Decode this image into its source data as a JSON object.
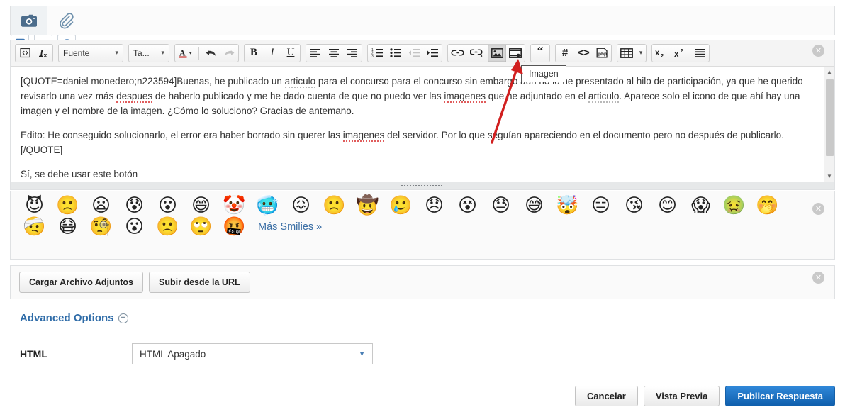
{
  "topbar": {
    "tabs": [
      {
        "name": "camera-tab",
        "icon": "camera-icon",
        "active": true
      },
      {
        "name": "attachment-tab",
        "icon": "paperclip-icon",
        "active": false
      }
    ],
    "right_icons": [
      {
        "name": "paste-icon",
        "label": "Pegar"
      },
      {
        "name": "font-format-icon",
        "label": "Formato de texto"
      },
      {
        "name": "smiley-icon",
        "label": "Smilies"
      }
    ]
  },
  "toolbar": {
    "groups": [
      {
        "buttons": [
          {
            "name": "source-code-button",
            "glyph": "source",
            "label": "Código fuente"
          },
          {
            "name": "remove-format-button",
            "glyph": "removeformat",
            "label": "Quitar formato"
          }
        ]
      },
      {
        "selects": [
          {
            "name": "font-select",
            "value": "Fuente",
            "width": 92
          },
          {
            "name": "size-select",
            "value": "Ta...",
            "width": 52
          }
        ]
      },
      {
        "buttons": [
          {
            "name": "text-color-button",
            "glyph": "textcolor",
            "label": "Color de texto"
          },
          {
            "name": "undo-button",
            "glyph": "undo",
            "label": "Deshacer"
          },
          {
            "name": "redo-button",
            "glyph": "redo",
            "label": "Rehacer",
            "disabled": true
          }
        ]
      },
      {
        "buttons": [
          {
            "name": "bold-button",
            "glyph": "B",
            "label": "Negrita"
          },
          {
            "name": "italic-button",
            "glyph": "I",
            "label": "Cursiva"
          },
          {
            "name": "underline-button",
            "glyph": "U",
            "label": "Subrayado"
          }
        ]
      },
      {
        "buttons": [
          {
            "name": "align-left-button",
            "glyph": "alignleft",
            "label": "Alinear a la izquierda"
          },
          {
            "name": "align-center-button",
            "glyph": "aligncenter",
            "label": "Centrar"
          },
          {
            "name": "align-right-button",
            "glyph": "alignright",
            "label": "Alinear a la derecha"
          }
        ]
      },
      {
        "buttons": [
          {
            "name": "ordered-list-button",
            "glyph": "numlist",
            "label": "Lista numerada"
          },
          {
            "name": "bullet-list-button",
            "glyph": "bullist",
            "label": "Lista con viñetas"
          },
          {
            "name": "outdent-button",
            "glyph": "outdent",
            "label": "Reducir sangría",
            "disabled": true
          },
          {
            "name": "indent-button",
            "glyph": "indent",
            "label": "Aumentar sangría"
          }
        ]
      },
      {
        "buttons": [
          {
            "name": "link-button",
            "glyph": "link",
            "label": "Enlace"
          },
          {
            "name": "unlink-button",
            "glyph": "unlink",
            "label": "Quitar enlace"
          },
          {
            "name": "image-button",
            "glyph": "image",
            "label": "Imagen",
            "pressed": true
          },
          {
            "name": "video-button",
            "glyph": "video",
            "label": "Vídeo"
          }
        ]
      },
      {
        "buttons": [
          {
            "name": "quote-button",
            "glyph": "quote",
            "label": "Cita"
          }
        ]
      },
      {
        "buttons": [
          {
            "name": "hash-button",
            "glyph": "hash",
            "label": "Etiqueta"
          },
          {
            "name": "code-button",
            "glyph": "code",
            "label": "Código"
          },
          {
            "name": "php-button",
            "glyph": "php",
            "label": "PHP"
          }
        ]
      },
      {
        "buttons": [
          {
            "name": "table-button",
            "glyph": "table",
            "label": "Tabla",
            "dropdown": true
          }
        ]
      },
      {
        "buttons": [
          {
            "name": "subscript-button",
            "glyph": "sub",
            "label": "Subíndice"
          },
          {
            "name": "superscript-button",
            "glyph": "sup",
            "label": "Superíndice"
          },
          {
            "name": "justify-button",
            "glyph": "justify",
            "label": "Justificar"
          }
        ]
      }
    ]
  },
  "tooltip": {
    "text": "Imagen"
  },
  "editor": {
    "paragraph1_a": "[QUOTE=daniel monedero;n223594]Buenas, he publicado un ",
    "paragraph1_sp1": "articulo",
    "paragraph1_b": " para el concurso para el concurso sin embargo aun no lo he presentado al hilo de participación, ya que he querido revisarlo una vez más ",
    "paragraph1_sp2": "despues",
    "paragraph1_c": " de haberlo publicado y me he dado cuenta de que no puedo ver las ",
    "paragraph1_sp3": "imagenes",
    "paragraph1_d": " que he adjuntado en el ",
    "paragraph1_sp4": "articulo",
    "paragraph1_e": ". Aparece solo el icono de que ahí hay una imagen y el nombre de la imagen. ¿Cómo lo soluciono? Gracias de antemano.",
    "paragraph2_a": "Edito: He conseguido solucionarlo, el error era haber borrado sin querer las ",
    "paragraph2_sp1": "imagenes",
    "paragraph2_b": " del servidor. Por lo que seguían apareciendo en el documento pero no después de publicarlo. [/QUOTE]",
    "paragraph3": "Sí, se debe usar este botón"
  },
  "smilies": {
    "row1": [
      "😈",
      "🙁",
      "😦",
      "😰",
      "😮",
      "😄",
      "🤡",
      "🥶",
      "😖",
      "🙁",
      "🤠",
      "🥲",
      "😞",
      "😵",
      "😓",
      "😅",
      "🤯",
      "😑",
      "😘",
      "😊",
      "😱",
      "🤢",
      "🤭"
    ],
    "row2": [
      "🤕",
      "😷",
      "🧐",
      "😮",
      "🙁",
      "🙄",
      "🤬"
    ],
    "more_label": "Más Smilies »"
  },
  "attachments": {
    "upload_button": "Cargar Archivo Adjuntos",
    "url_button": "Subir desde la URL"
  },
  "advanced": {
    "title": "Advanced Options",
    "toggle_glyph": "−",
    "html_label": "HTML",
    "html_value": "HTML Apagado"
  },
  "footer": {
    "cancel": "Cancelar",
    "preview": "Vista Previa",
    "submit": "Publicar Respuesta"
  },
  "close_buttons": [
    {
      "name": "close-editor-panel"
    },
    {
      "name": "close-smilies-panel"
    },
    {
      "name": "close-attachments-panel"
    }
  ],
  "colors": {
    "link": "#3a6ea5",
    "heading": "#2f6ca8",
    "primary_button": "#1565b0",
    "arrow": "#d11f1f"
  }
}
